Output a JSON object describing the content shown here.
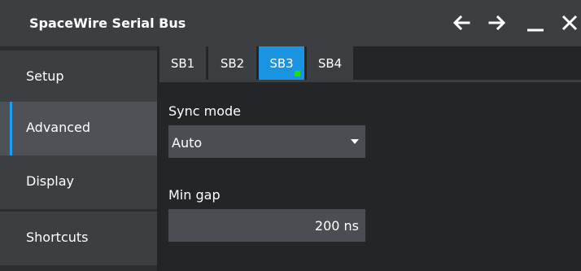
{
  "window": {
    "title": "SpaceWire Serial Bus",
    "buttons": {
      "back_icon": "left-arrow",
      "forward_icon": "right-arrow",
      "minimize_icon": "minimize",
      "close_icon": "close"
    }
  },
  "sidebar": {
    "items": [
      {
        "label": "Setup",
        "active": false
      },
      {
        "label": "Advanced",
        "active": true
      },
      {
        "label": "Display",
        "active": false
      },
      {
        "label": "Shortcuts",
        "active": false
      }
    ]
  },
  "tabs": [
    {
      "label": "SB1",
      "active": false
    },
    {
      "label": "SB2",
      "active": false
    },
    {
      "label": "SB3",
      "active": true,
      "indicator": "green"
    },
    {
      "label": "SB4",
      "active": false
    }
  ],
  "form": {
    "sync_mode": {
      "label": "Sync mode",
      "value": "Auto"
    },
    "min_gap": {
      "label": "Min gap",
      "value": "200 ns"
    }
  },
  "colors": {
    "accent": "#1a93e0",
    "tab_indicator": "#19e019"
  }
}
